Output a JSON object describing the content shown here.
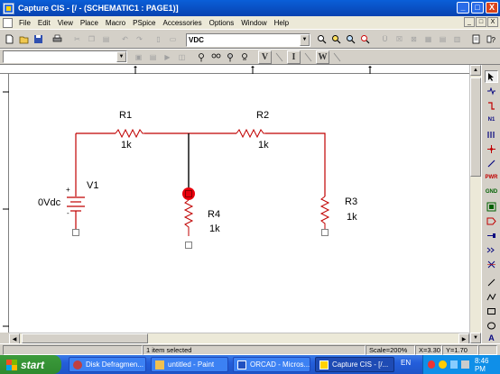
{
  "window": {
    "title": "Capture CIS - [/ - (SCHEMATIC1 : PAGE1)]",
    "controls": [
      "_",
      "□",
      "X"
    ]
  },
  "menubar": {
    "items": [
      "File",
      "Edit",
      "View",
      "Place",
      "Macro",
      "PSpice",
      "Accessories",
      "Options",
      "Window",
      "Help"
    ],
    "doc_controls": [
      "_",
      "□",
      "X"
    ]
  },
  "toolbar": {
    "part_combo_value": "VDC",
    "text_buttons": [
      "V",
      "I",
      "W"
    ]
  },
  "schematic": {
    "source": {
      "refdes": "V1",
      "value": "0Vdc",
      "plus": "+",
      "minus": "-"
    },
    "resistors": [
      {
        "refdes": "R1",
        "value": "1k"
      },
      {
        "refdes": "R2",
        "value": "1k"
      },
      {
        "refdes": "R3",
        "value": "1k"
      },
      {
        "refdes": "R4",
        "value": "1k"
      }
    ],
    "wire_color": "#c00000",
    "selected_wire_color": "#000000",
    "pin_marker_color": "#e8000c"
  },
  "statusbar": {
    "message": "1 item selected",
    "scale": "Scale=200%",
    "x": "X=3.30",
    "y": "Y=1.70"
  },
  "taskbar": {
    "start_label": "start",
    "buttons": [
      {
        "label": "Disk Defragmen...",
        "icon": "defrag-icon"
      },
      {
        "label": "untitled - Paint",
        "icon": "paint-icon"
      },
      {
        "label": "ORCAD - Micros...",
        "icon": "word-icon"
      },
      {
        "label": "Capture CIS - [/...",
        "icon": "capture-icon"
      }
    ],
    "language": "EN",
    "clock": "8:46 PM"
  }
}
